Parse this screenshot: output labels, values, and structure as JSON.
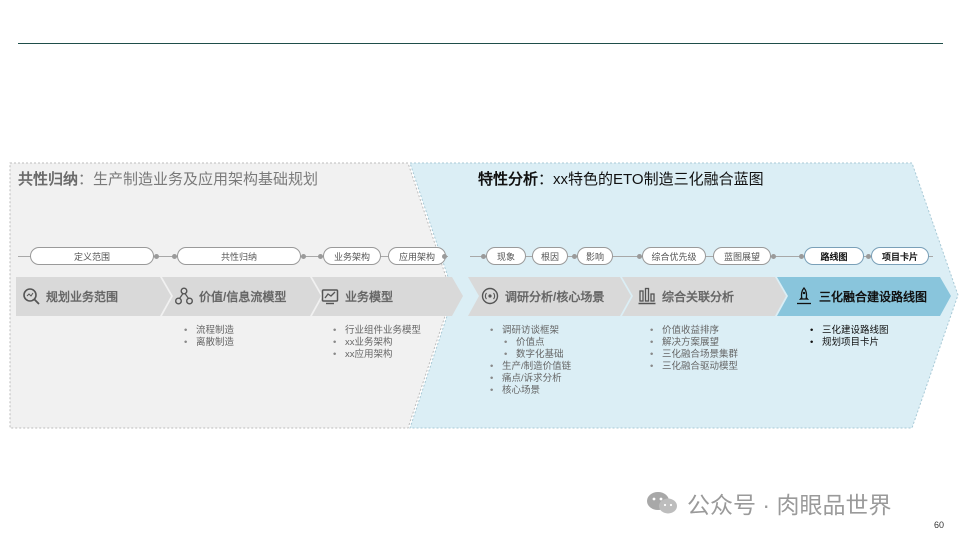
{
  "left_title": {
    "bold": "共性归纳",
    "rest": "：生产制造业务及应用架构基础规划"
  },
  "right_title": {
    "bold": "特性分析",
    "rest": "：xx特色的ETO制造三化融合蓝图"
  },
  "pills": [
    "定义范围",
    "共性归纳",
    "业务架构",
    "应用架构",
    "现象",
    "根因",
    "影响",
    "综合优先级",
    "蓝图展望",
    "路线图",
    "项目卡片"
  ],
  "stages": [
    {
      "label": "规划业务范围",
      "icon": "search-scope-icon"
    },
    {
      "label": "价值/信息流模型",
      "icon": "network-nodes-icon"
    },
    {
      "label": "业务模型",
      "icon": "business-model-icon"
    },
    {
      "label": "调研分析/核心场景",
      "icon": "radar-icon"
    },
    {
      "label": "综合关联分析",
      "icon": "bar-analysis-icon"
    },
    {
      "label": "三化融合建设路线图",
      "icon": "rocket-icon"
    }
  ],
  "bullets": {
    "value_flow": [
      "流程制造",
      "离散制造"
    ],
    "business_model": [
      "行业组件业务模型",
      "xx业务架构",
      "xx应用架构"
    ],
    "research": [
      "调研访谈框架",
      "价值点",
      "数字化基础",
      "生产/制造价值链",
      "痛点/诉求分析",
      "核心场景"
    ],
    "correlation": [
      "价值收益排序",
      "解决方案展望",
      "三化融合场景集群",
      "三化融合驱动模型"
    ],
    "roadmap": [
      "三化建设路线图",
      "规划项目卡片"
    ]
  },
  "watermark": "公众号 · 肉眼品世界",
  "page_number": "60",
  "colors": {
    "left_panel": "#f1f1f1",
    "right_panel": "#dbeef5",
    "stage_grey": "#d9d9d9",
    "stage_blue": "#89c5dc",
    "rule": "#1f4e4a"
  }
}
